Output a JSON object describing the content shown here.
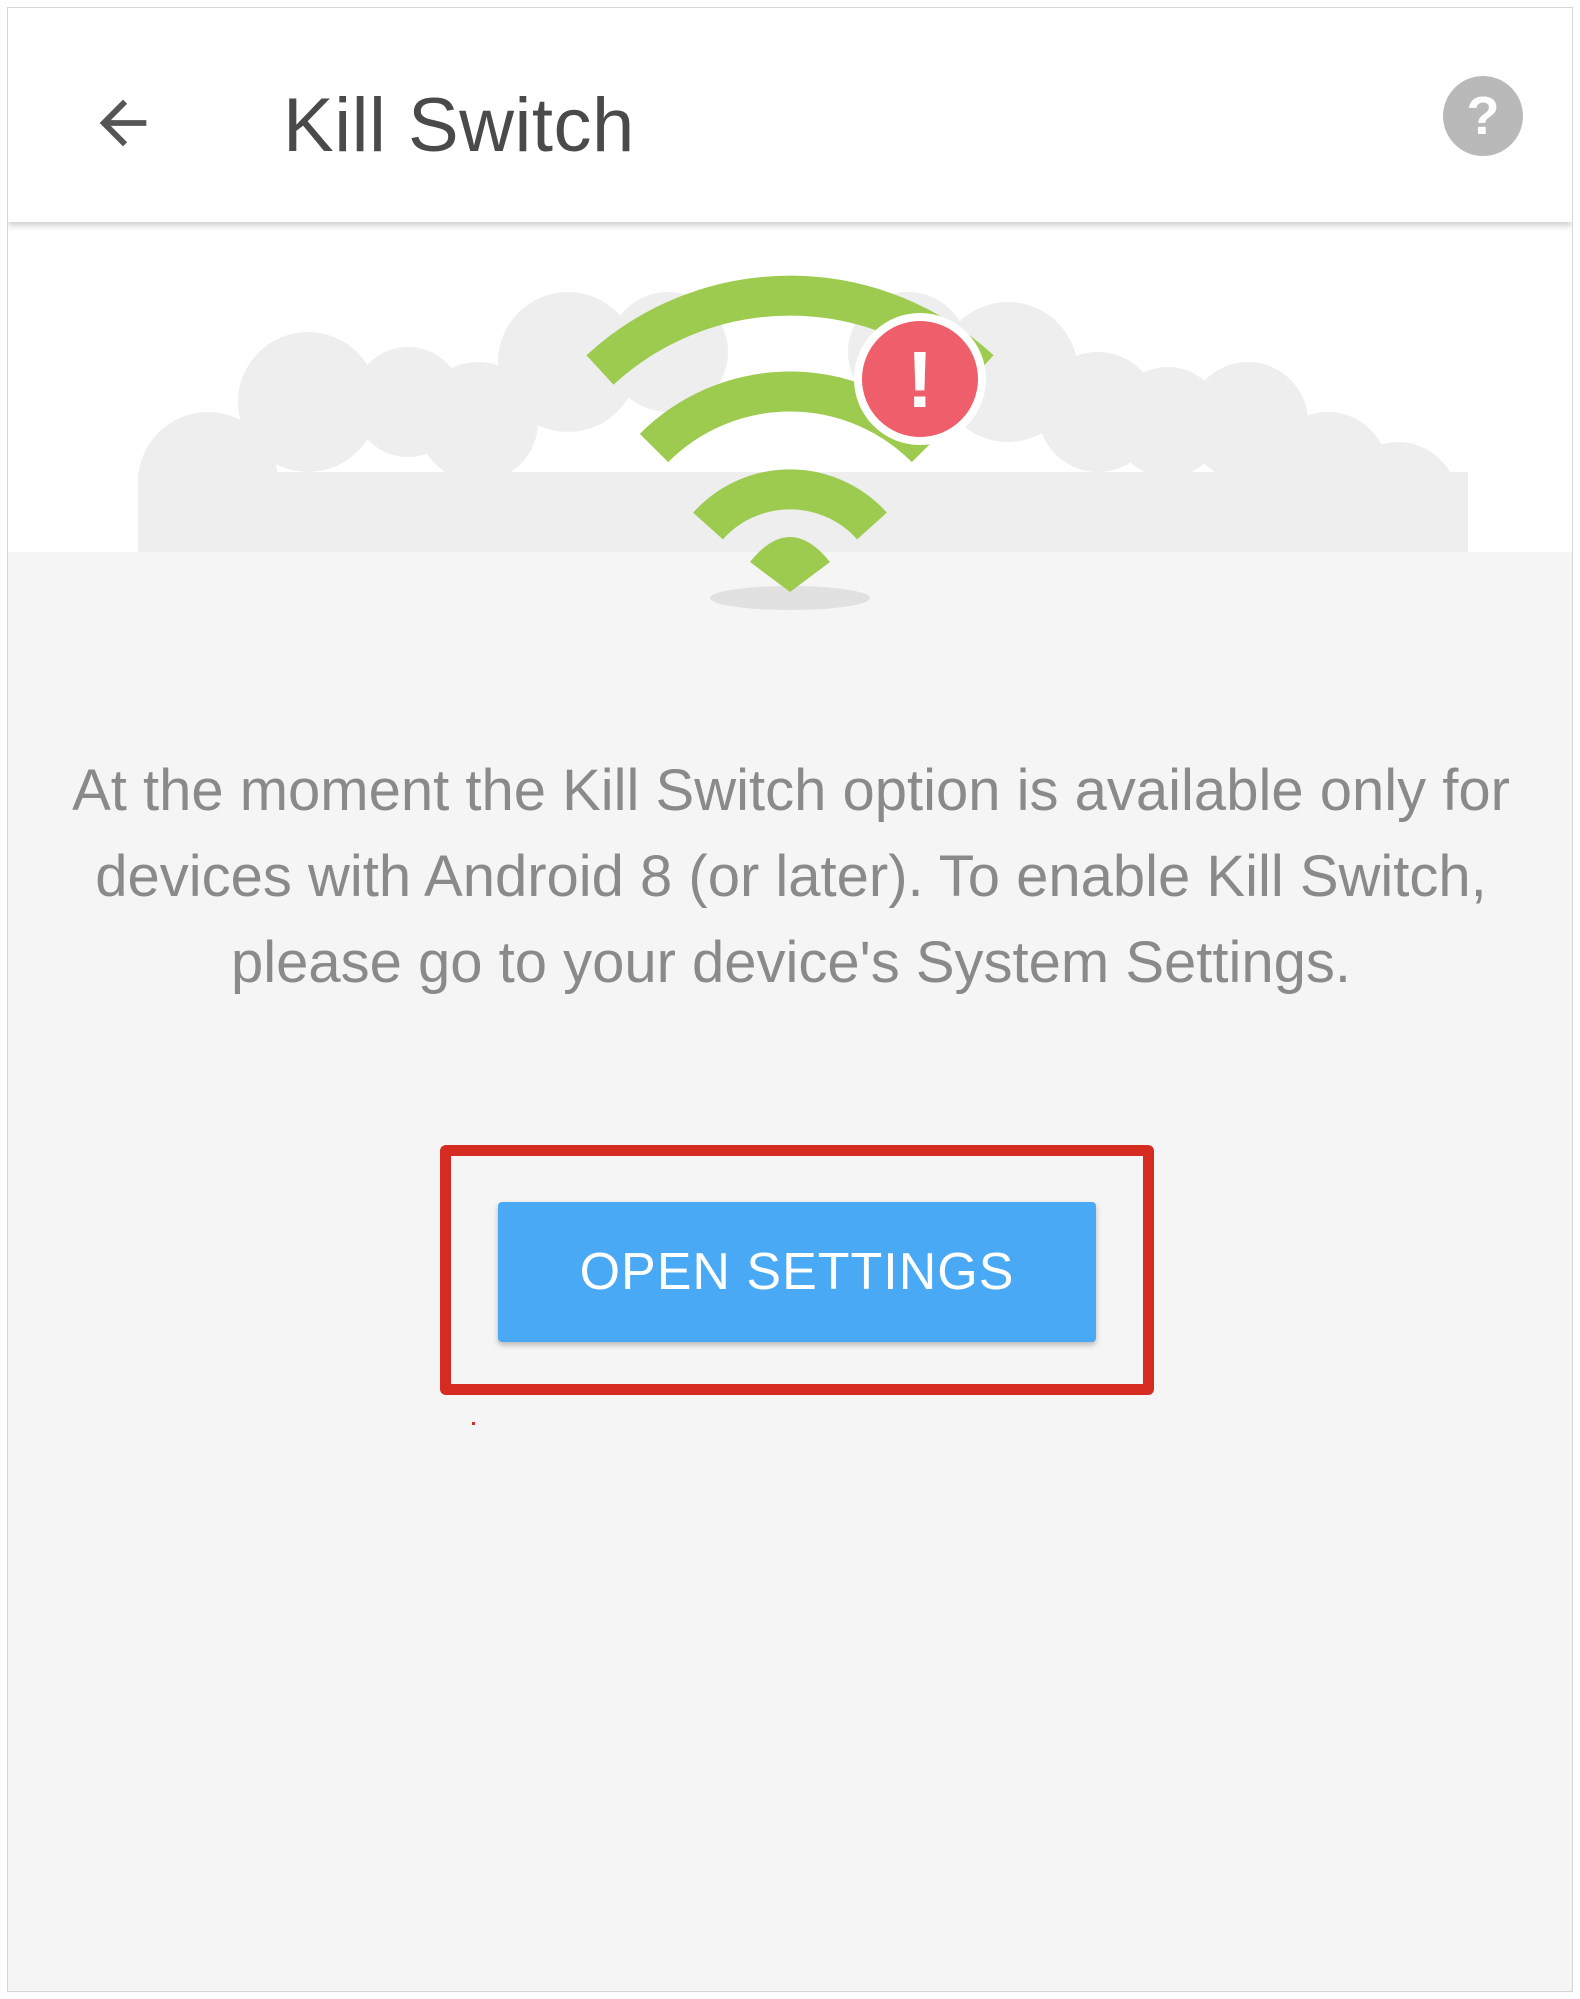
{
  "appbar": {
    "title": "Kill Switch",
    "back_icon": "arrow-left-icon",
    "help_label": "?",
    "help_icon": "help-circle-icon"
  },
  "hero": {
    "illustration": "wifi-warning-icon",
    "warning_mark": "!"
  },
  "main": {
    "message": "At the moment the Kill Switch option is available only for devices with Android 8 (or later). To enable Kill Switch, please go to your device's System Settings.",
    "open_settings_label": "OPEN SETTINGS"
  },
  "colors": {
    "wifi_green": "#9dcb4f",
    "warning_red": "#ef5f6b",
    "button_blue": "#4aa9f5",
    "highlight_red": "#d52b20",
    "text_gray": "#8a8a8a"
  }
}
